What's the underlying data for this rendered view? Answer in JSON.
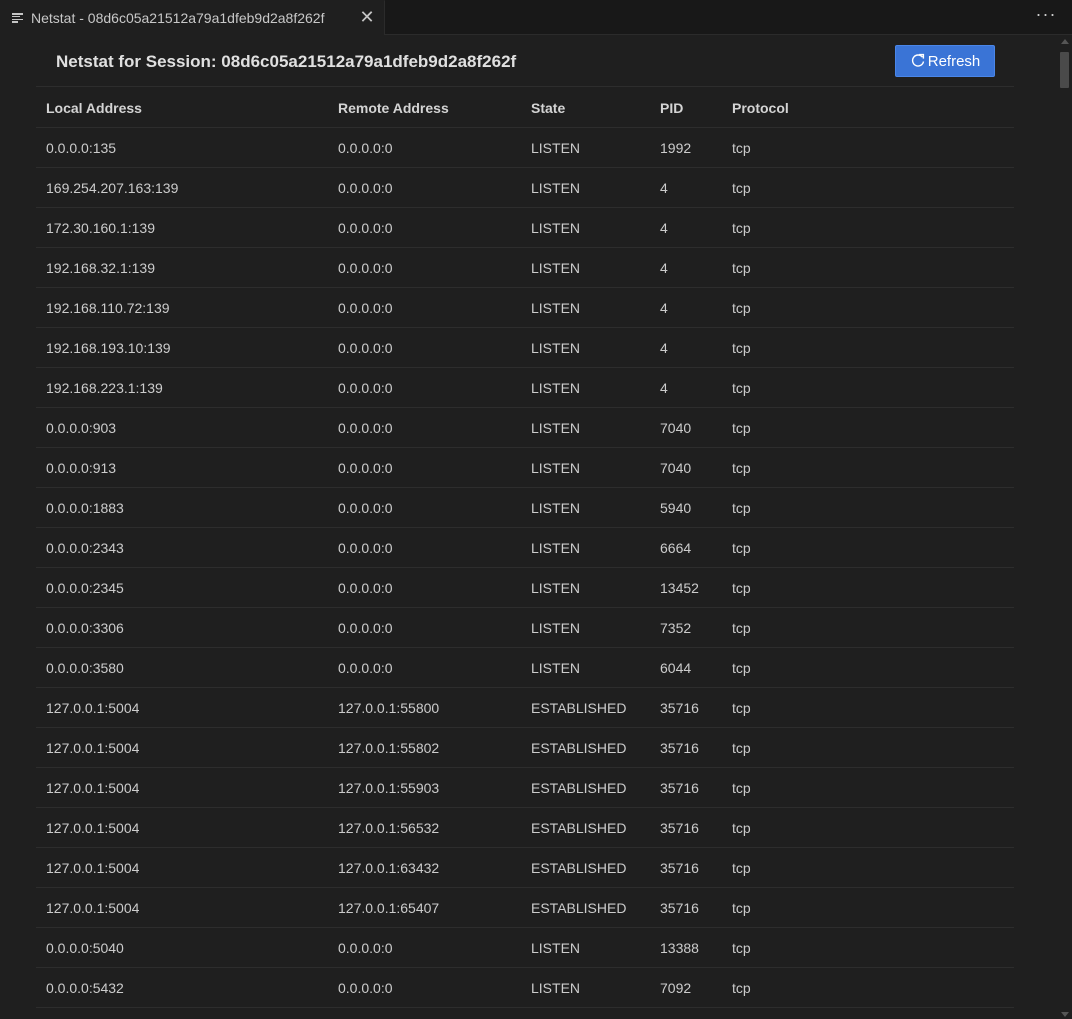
{
  "tab": {
    "title": "Netstat - 08d6c05a21512a79a1dfeb9d2a8f262f",
    "close_glyph": "✕",
    "more_glyph": "···"
  },
  "header": {
    "title": "Netstat for Session: 08d6c05a21512a79a1dfeb9d2a8f262f",
    "refresh_label": "Refresh",
    "refresh_color": "#3a74d6"
  },
  "table": {
    "columns": [
      "Local Address",
      "Remote Address",
      "State",
      "PID",
      "Protocol"
    ],
    "rows": [
      [
        "0.0.0.0:135",
        "0.0.0.0:0",
        "LISTEN",
        "1992",
        "tcp"
      ],
      [
        "169.254.207.163:139",
        "0.0.0.0:0",
        "LISTEN",
        "4",
        "tcp"
      ],
      [
        "172.30.160.1:139",
        "0.0.0.0:0",
        "LISTEN",
        "4",
        "tcp"
      ],
      [
        "192.168.32.1:139",
        "0.0.0.0:0",
        "LISTEN",
        "4",
        "tcp"
      ],
      [
        "192.168.110.72:139",
        "0.0.0.0:0",
        "LISTEN",
        "4",
        "tcp"
      ],
      [
        "192.168.193.10:139",
        "0.0.0.0:0",
        "LISTEN",
        "4",
        "tcp"
      ],
      [
        "192.168.223.1:139",
        "0.0.0.0:0",
        "LISTEN",
        "4",
        "tcp"
      ],
      [
        "0.0.0.0:903",
        "0.0.0.0:0",
        "LISTEN",
        "7040",
        "tcp"
      ],
      [
        "0.0.0.0:913",
        "0.0.0.0:0",
        "LISTEN",
        "7040",
        "tcp"
      ],
      [
        "0.0.0.0:1883",
        "0.0.0.0:0",
        "LISTEN",
        "5940",
        "tcp"
      ],
      [
        "0.0.0.0:2343",
        "0.0.0.0:0",
        "LISTEN",
        "6664",
        "tcp"
      ],
      [
        "0.0.0.0:2345",
        "0.0.0.0:0",
        "LISTEN",
        "13452",
        "tcp"
      ],
      [
        "0.0.0.0:3306",
        "0.0.0.0:0",
        "LISTEN",
        "7352",
        "tcp"
      ],
      [
        "0.0.0.0:3580",
        "0.0.0.0:0",
        "LISTEN",
        "6044",
        "tcp"
      ],
      [
        "127.0.0.1:5004",
        "127.0.0.1:55800",
        "ESTABLISHED",
        "35716",
        "tcp"
      ],
      [
        "127.0.0.1:5004",
        "127.0.0.1:55802",
        "ESTABLISHED",
        "35716",
        "tcp"
      ],
      [
        "127.0.0.1:5004",
        "127.0.0.1:55903",
        "ESTABLISHED",
        "35716",
        "tcp"
      ],
      [
        "127.0.0.1:5004",
        "127.0.0.1:56532",
        "ESTABLISHED",
        "35716",
        "tcp"
      ],
      [
        "127.0.0.1:5004",
        "127.0.0.1:63432",
        "ESTABLISHED",
        "35716",
        "tcp"
      ],
      [
        "127.0.0.1:5004",
        "127.0.0.1:65407",
        "ESTABLISHED",
        "35716",
        "tcp"
      ],
      [
        "0.0.0.0:5040",
        "0.0.0.0:0",
        "LISTEN",
        "13388",
        "tcp"
      ],
      [
        "0.0.0.0:5432",
        "0.0.0.0:0",
        "LISTEN",
        "7092",
        "tcp"
      ]
    ]
  }
}
